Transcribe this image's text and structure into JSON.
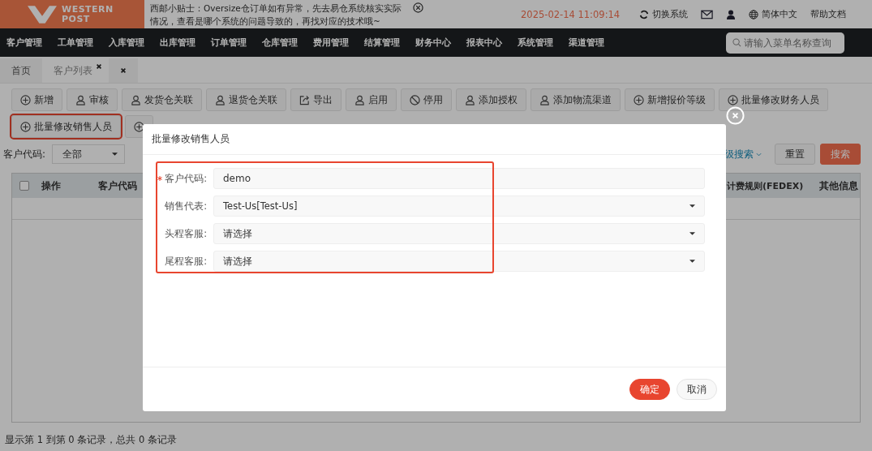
{
  "header": {
    "logo": [
      "WESTERN",
      "POST"
    ],
    "notice": "西邮小贴士：Oversize仓订单如有异常，先去易仓系统核实实际情况，查看是哪个系统的问题导致的，再找对应的技术哦~",
    "datetime": "2025-02-14 11:09:14",
    "actions": [
      {
        "kind": "switch",
        "label": "切换系统"
      },
      {
        "kind": "mail"
      },
      {
        "kind": "user"
      },
      {
        "kind": "language",
        "label": "简体中文"
      },
      {
        "kind": "help",
        "label": "帮助文档"
      }
    ]
  },
  "nav": {
    "items": [
      "客户管理",
      "工单管理",
      "入库管理",
      "出库管理",
      "订单管理",
      "仓库管理",
      "费用管理",
      "结算管理",
      "财务中心",
      "报表中心",
      "系统管理",
      "渠道管理"
    ],
    "search": {
      "placeholder": "请输入菜单名称查询"
    }
  },
  "tabs": [
    {
      "label": "首页",
      "selected": false
    },
    {
      "label": "客户列表",
      "selected": true
    }
  ],
  "toolbar": [
    [
      {
        "kind": "plus",
        "label": "新增",
        "highlighted": false
      },
      {
        "kind": "user",
        "label": "审核",
        "highlighted": false
      },
      {
        "kind": "user",
        "label": "发货仓关联",
        "highlighted": false
      },
      {
        "kind": "user",
        "label": "退货仓关联",
        "highlighted": false
      },
      {
        "kind": "export",
        "label": "导出",
        "highlighted": false
      },
      {
        "kind": "user",
        "label": "启用",
        "highlighted": false
      },
      {
        "kind": "ban",
        "label": "停用",
        "highlighted": false
      },
      {
        "kind": "user",
        "label": "添加授权",
        "highlighted": false
      },
      {
        "kind": "user",
        "label": "添加物流渠道",
        "highlighted": false
      },
      {
        "kind": "plus",
        "label": "新增报价等级",
        "highlighted": false
      },
      {
        "kind": "plus",
        "label": "批量修改财务人员",
        "highlighted": false
      }
    ],
    [
      {
        "kind": "plus",
        "label": "批量修改销售人员",
        "highlighted": true
      },
      {
        "kind": "plus",
        "highlighted": false
      }
    ]
  ],
  "filter": {
    "label": "客户代码:",
    "value": "全部",
    "advanced": "级搜索",
    "buttons": [
      {
        "label": "重置",
        "primary": false
      },
      {
        "label": "搜索",
        "primary": true
      }
    ]
  },
  "table": {
    "columns": [
      "操作",
      "客户代码",
      "计费规则(FEDEX)",
      "其他信息"
    ],
    "checked": false
  },
  "footer": "显示第 1 到第 0 条记录，总共 0 条记录",
  "dialog": {
    "title": "批量修改销售人员",
    "fields_highlighted": true,
    "fields": [
      {
        "kind": "input",
        "label": "客户代码:",
        "required": true,
        "value": "demo"
      },
      {
        "kind": "select",
        "label": "销售代表:",
        "required": false,
        "value": "Test-Us[Test-Us]"
      },
      {
        "kind": "select",
        "label": "头程客服:",
        "required": false,
        "placeholder": "请选择"
      },
      {
        "kind": "select",
        "label": "尾程客服:",
        "required": false,
        "placeholder": "请选择"
      }
    ],
    "buttons": [
      {
        "label": "确定",
        "primary": true
      },
      {
        "label": "取消",
        "primary": false
      }
    ]
  }
}
